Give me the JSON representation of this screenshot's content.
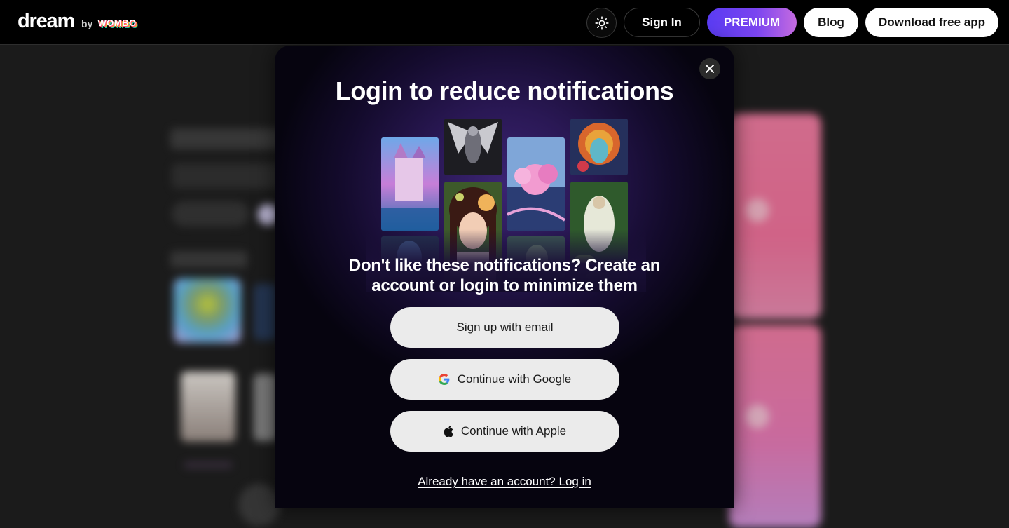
{
  "header": {
    "brand_name": "dream",
    "brand_by": "by",
    "brand_partner": "WOMBO",
    "theme_icon": "sun-icon",
    "signin_label": "Sign In",
    "premium_label": "PREMIUM",
    "blog_label": "Blog",
    "download_label": "Download free app"
  },
  "modal": {
    "close_icon": "close-icon",
    "title": "Login to reduce notifications",
    "subtitle": "Don't like these notifications? Create an account or login to minimize them",
    "buttons": {
      "email": "Sign up with email",
      "google": "Continue with Google",
      "apple": "Continue with Apple"
    },
    "login_prompt": "Already have an account? Log in"
  },
  "colors": {
    "premium_gradient_start": "#5a3cf2",
    "premium_gradient_end": "#c56be0",
    "modal_glow": "#3b2472",
    "button_bg": "#ebebeb"
  }
}
